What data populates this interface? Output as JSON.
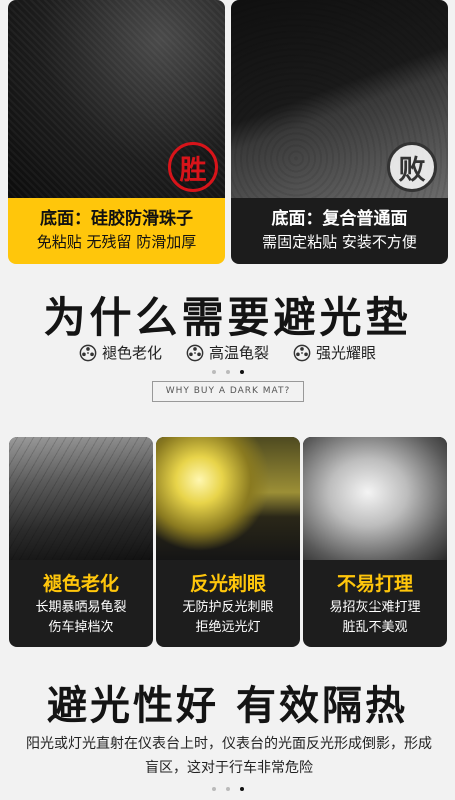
{
  "comparison": {
    "good": {
      "stamp": "胜",
      "title": "底面：硅胶防滑珠子",
      "subtitle": "免粘贴 无残留 防滑加厚"
    },
    "bad": {
      "stamp": "败",
      "title": "底面：复合普通面",
      "subtitle": "需固定粘贴 安装不方便"
    }
  },
  "why": {
    "title": "为什么需要避光垫",
    "issues": [
      "褪色老化",
      "高温龟裂",
      "强光耀眼"
    ],
    "english": "WHY BUY A DARK MAT?"
  },
  "problems": [
    {
      "title": "褪色老化",
      "line1": "长期暴晒易龟裂",
      "line2": "伤车掉档次"
    },
    {
      "title": "反光刺眼",
      "line1": "无防护反光刺眼",
      "line2": "拒绝远光灯"
    },
    {
      "title": "不易打理",
      "line1": "易招灰尘难打理",
      "line2": "脏乱不美观"
    }
  ],
  "benefit": {
    "title": "避光性好 有效隔热",
    "text": "阳光或灯光直射在仪表台上时，仪表台的光面反光形成倒影，形成盲区，这对于行车非常危险"
  },
  "colors": {
    "accent": "#ffc60b",
    "danger": "#d8141a",
    "dark": "#1c1c1c"
  }
}
